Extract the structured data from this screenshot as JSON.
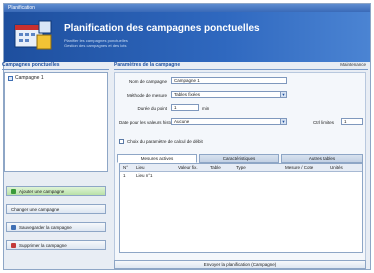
{
  "window": {
    "title": "Planification"
  },
  "banner": {
    "title": "Planification des campagnes ponctuelles",
    "subtitle_lines": [
      "Planifier les campagnes ponctuelles",
      "Gestion des campagnes et des lots"
    ]
  },
  "left_panel": {
    "header": "Campagnes ponctuelles",
    "tree_items": [
      "Campagne 1"
    ],
    "buttons": [
      {
        "label": "Ajouter une campagne",
        "icon": "add-icon",
        "active": true,
        "color": "#3a9a3a"
      },
      {
        "label": "Changer une campagne",
        "icon": "edit-icon",
        "active": false,
        "color": "#3f6fb4"
      },
      {
        "label": "Sauvegarder la campagne",
        "icon": "save-icon",
        "active": false,
        "color": "#3f6fb4"
      },
      {
        "label": "Supprimer la campagne",
        "icon": "delete-icon",
        "active": false,
        "color": "#c33a3a"
      }
    ]
  },
  "right_panel": {
    "header": "Paramètres de la campagne",
    "header_right": "Maintenance",
    "form": {
      "name_label": "Nom de campagne",
      "name_value": "Campagne 1",
      "method_label": "Méthode de mesure",
      "method_value": "Tables fixées",
      "duration_label": "Durée du point",
      "duration_value": "1",
      "duration_unit": "min",
      "date_label": "Date pour les valeurs historiques",
      "date_value": "Aucune",
      "extra_label": "Ctrl limites",
      "extra_value": "1",
      "checkbox_label": "Choix du paramètre de calcul de débit"
    },
    "tabs": [
      "Mesures actives",
      "Caractéristiques",
      "Autres tables"
    ],
    "grid": {
      "columns": [
        "N°",
        "Lieu",
        "Valeur fix.",
        "Table",
        "Type",
        "Mesure / Cote",
        "Unités"
      ],
      "rows": [
        [
          "1",
          "Lieu n°1",
          "",
          "",
          "",
          "",
          ""
        ]
      ]
    },
    "bottom_button": "Envoyer la planification (Campagne)"
  },
  "colors": {
    "brand_blue": "#1e4f9e",
    "panel_bg": "#e8edf4",
    "active_button": "#b9e1a7"
  }
}
